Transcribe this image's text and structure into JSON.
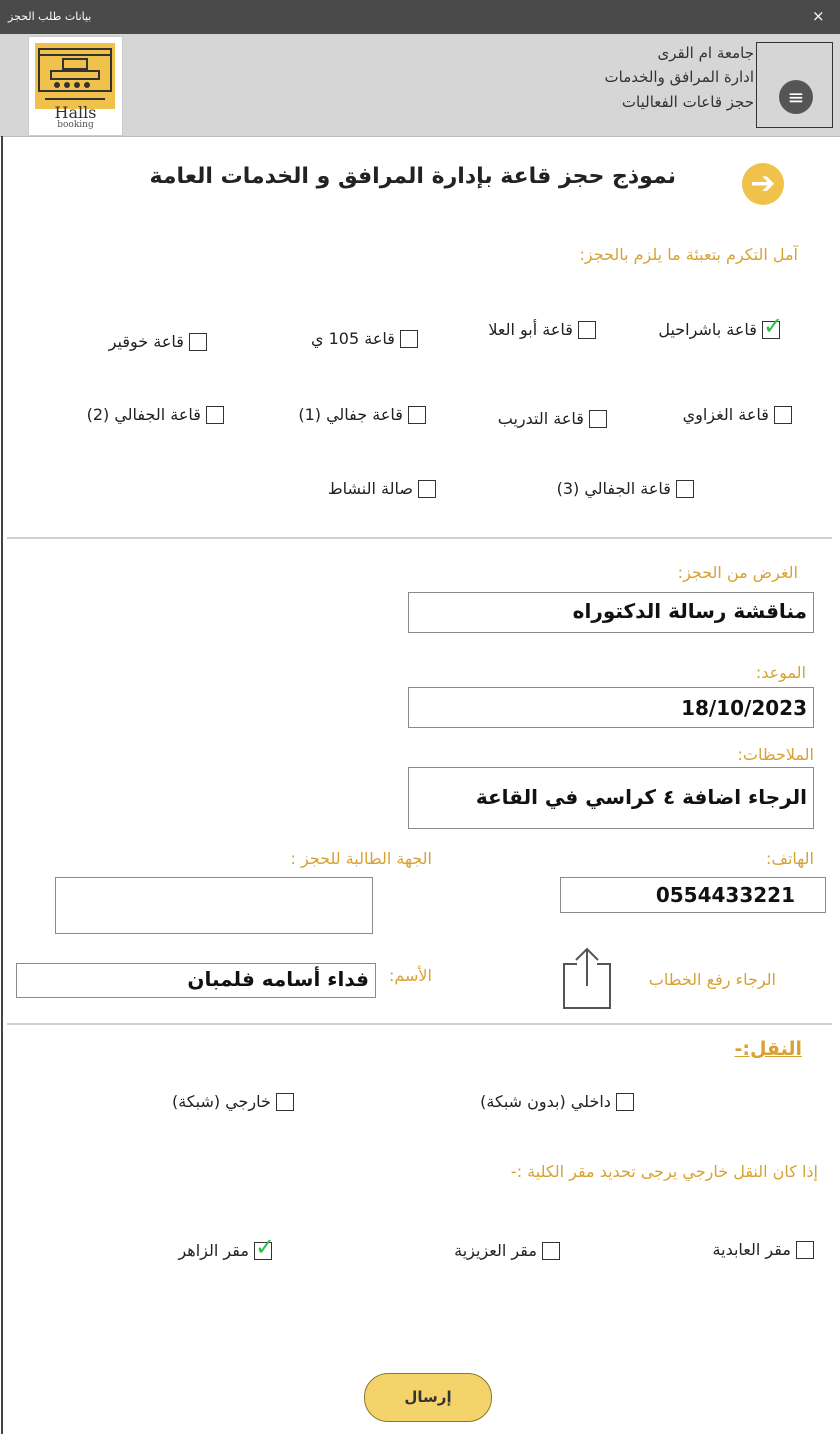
{
  "window": {
    "title": "بيانات طلب الحجز",
    "close_symbol": "×"
  },
  "header": {
    "logo": {
      "line1": "Halls",
      "line2": "booking"
    },
    "lines": [
      "جامعة ام القرى",
      "ادارة المرافق والخدمات",
      "حجز قاعات الفعاليات"
    ],
    "menu_symbol": "≡"
  },
  "form": {
    "title": "نموذج حجز قاعة بإدارة المرافق و الخدمات العامة",
    "arrow_symbol": "➔",
    "instruction": "آمل التكرم بتعبئة ما يلزم بالحجز:",
    "halls": [
      {
        "label": "قاعة باشراحيل",
        "checked": true
      },
      {
        "label": "قاعة أبو العلا",
        "checked": false
      },
      {
        "label": "قاعة 105 ي",
        "checked": false
      },
      {
        "label": "قاعة خوقير",
        "checked": false
      },
      {
        "label": "قاعة الغزاوي",
        "checked": false
      },
      {
        "label": "قاعة التدريب",
        "checked": false
      },
      {
        "label": "قاعة جفالي (1)",
        "checked": false
      },
      {
        "label": "قاعة الجفالي (2)",
        "checked": false
      },
      {
        "label": "قاعة الجفالي (3)",
        "checked": false
      },
      {
        "label": "صالة النشاط",
        "checked": false
      }
    ],
    "purpose": {
      "label": "الغرض من الحجز:",
      "value": "مناقشة رسالة الدكتوراه"
    },
    "date": {
      "label": "الموعد:",
      "value": "18/10/2023"
    },
    "notes": {
      "label": "الملاحظات:",
      "value": "الرجاء اضافة ٤ كراسي في القاعة"
    },
    "phone": {
      "label": "الهاتف:",
      "value": "0554433221"
    },
    "requesting_party": {
      "label": "الجهة الطالبة للحجز :",
      "value": ""
    },
    "upload_label": "الرجاء رفع الخطاب",
    "name": {
      "label": "الأسم:",
      "value": "فداء أسامه فلمبان"
    },
    "transport": {
      "title": "النقل:-",
      "options": [
        {
          "label": "داخلي (بدون شبكة)",
          "checked": false
        },
        {
          "label": "خارجي (شبكة)",
          "checked": false
        }
      ]
    },
    "college_question": "إذا كان النقل خارجي يرجى تحديد مقر الكلية :-",
    "colleges": [
      {
        "label": "مقر العابدية",
        "checked": false
      },
      {
        "label": "مقر العزيزية",
        "checked": false
      },
      {
        "label": "مقر الزاهر",
        "checked": true
      }
    ],
    "submit_label": "إرسال",
    "tick_symbol": "✓"
  }
}
